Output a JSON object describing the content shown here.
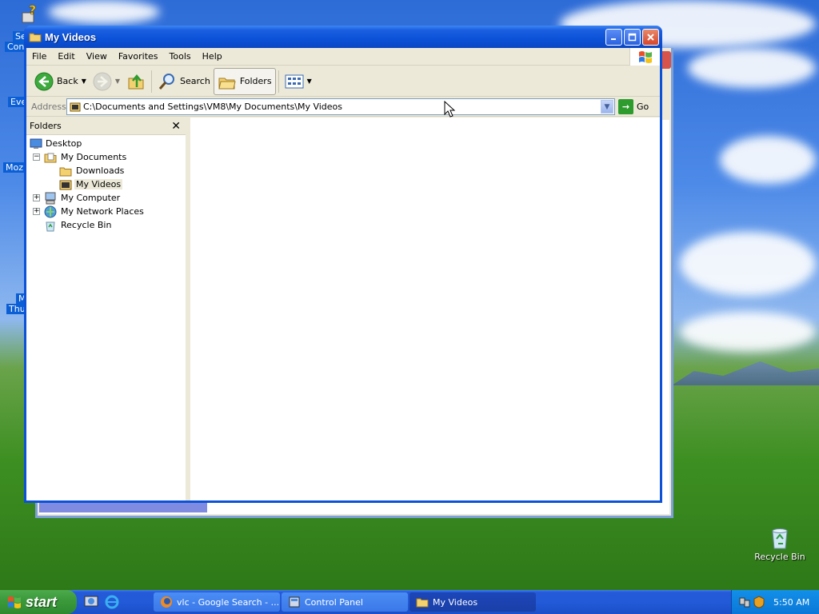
{
  "desktop": {
    "icons": [
      {
        "label": "Recycle Bin"
      }
    ],
    "partial_labels": [
      "Se",
      "Conf",
      "Eve",
      "Mozil",
      "M",
      "Thur"
    ]
  },
  "window": {
    "title": "My Videos",
    "menu": [
      "File",
      "Edit",
      "View",
      "Favorites",
      "Tools",
      "Help"
    ],
    "toolbar": {
      "back_label": "Back",
      "search_label": "Search",
      "folders_label": "Folders"
    },
    "address": {
      "label": "Address",
      "value": "C:\\Documents and Settings\\VM8\\My Documents\\My Videos",
      "go_label": "Go"
    },
    "folders_pane": {
      "title": "Folders",
      "tree": [
        {
          "label": "Desktop"
        },
        {
          "label": "My Documents"
        },
        {
          "label": "Downloads"
        },
        {
          "label": "My Videos"
        },
        {
          "label": "My Computer"
        },
        {
          "label": "My Network Places"
        },
        {
          "label": "Recycle Bin"
        }
      ]
    }
  },
  "taskbar": {
    "start_label": "start",
    "tasks": [
      {
        "label": "vlc - Google Search - ..."
      },
      {
        "label": "Control Panel"
      },
      {
        "label": "My Videos"
      }
    ],
    "clock": "5:50 AM"
  }
}
